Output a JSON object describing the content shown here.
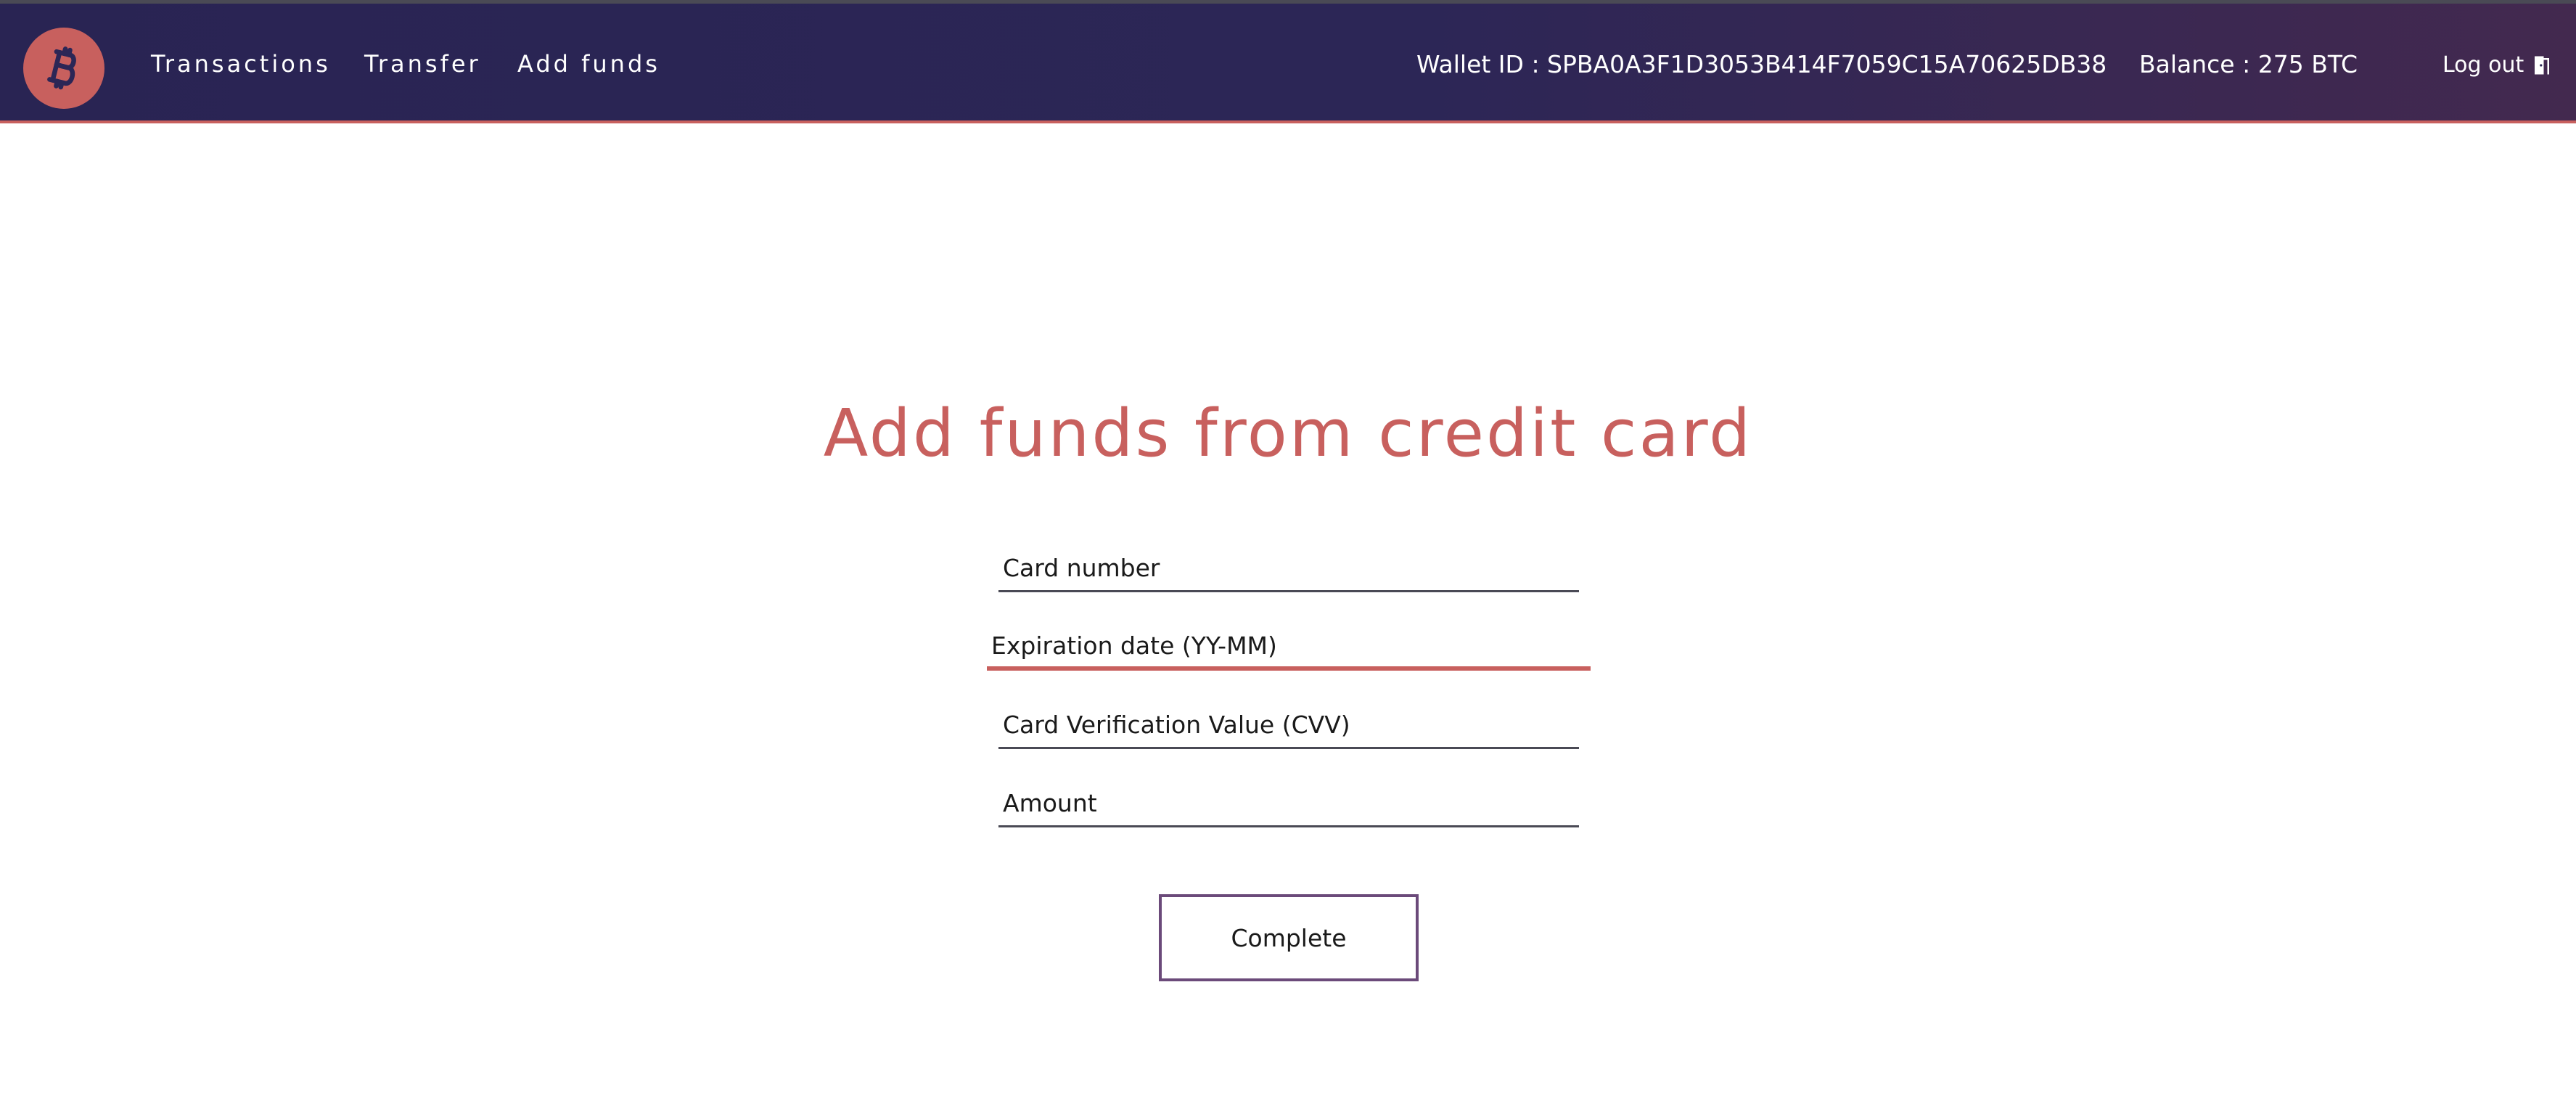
{
  "header": {
    "logo_icon": "bitcoin-icon",
    "nav": {
      "transactions": "Transactions",
      "transfer": "Transfer",
      "add_funds": "Add funds"
    },
    "wallet_label": "Wallet ID : SPBA0A3F1D3053B414F7059C15A70625DB38",
    "balance_label": "Balance : 275 BTC",
    "logout_label": "Log out",
    "logout_icon": "door-exit-icon"
  },
  "main": {
    "title": "Add funds from credit card",
    "fields": {
      "card_number": {
        "placeholder": "Card number",
        "value": ""
      },
      "expiration": {
        "placeholder": "Expiration date (YY-MM)",
        "value": ""
      },
      "cvv": {
        "placeholder": "Card Verification Value (CVV)",
        "value": ""
      },
      "amount": {
        "placeholder": "Amount",
        "value": ""
      }
    },
    "submit_label": "Complete"
  },
  "colors": {
    "accent": "#c8605e",
    "header_bg": "#2c2656",
    "button_border": "#6b4a7a"
  }
}
